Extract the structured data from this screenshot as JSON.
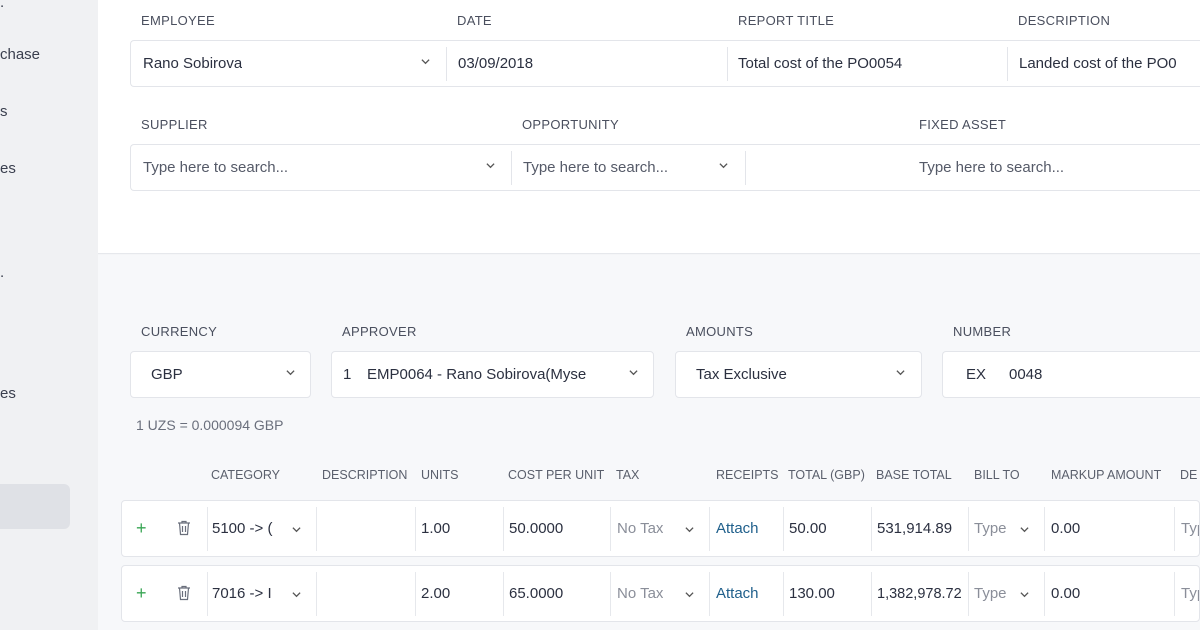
{
  "sidebar": {
    "items": [
      {
        "label": "."
      },
      {
        "label": "chase"
      },
      {
        "label": "s"
      },
      {
        "label": "es"
      },
      {
        "label": "."
      },
      {
        "label": "es"
      }
    ]
  },
  "header_form": {
    "employee": {
      "label": "EMPLOYEE",
      "value": "Rano Sobirova"
    },
    "date": {
      "label": "DATE",
      "value": "03/09/2018"
    },
    "report_title": {
      "label": "REPORT TITLE",
      "value": "Total cost of the PO0054"
    },
    "description": {
      "label": "DESCRIPTION",
      "value": "Landed cost of the PO0"
    },
    "supplier": {
      "label": "SUPPLIER",
      "placeholder": "Type here to search..."
    },
    "opportunity": {
      "label": "OPPORTUNITY",
      "placeholder": "Type here to search..."
    },
    "fixed_asset": {
      "label": "FIXED ASSET",
      "placeholder": "Type here to search..."
    }
  },
  "settings": {
    "currency": {
      "label": "CURRENCY",
      "value": "GBP"
    },
    "approver": {
      "label": "APPROVER",
      "index": "1",
      "value": "EMP0064 - Rano Sobirova(Myse"
    },
    "amounts": {
      "label": "AMOUNTS",
      "value": "Tax Exclusive"
    },
    "number": {
      "label": "NUMBER",
      "prefix": "EX",
      "value": "0048"
    },
    "rate": "1 UZS = 0.000094 GBP"
  },
  "table": {
    "columns": {
      "category": "CATEGORY",
      "description": "DESCRIPTION",
      "units": "UNITS",
      "cost_per_unit": "COST PER UNIT",
      "tax": "TAX",
      "receipts": "RECEIPTS",
      "total": "TOTAL (GBP)",
      "base_total": "BASE TOTAL",
      "bill_to": "BILL TO",
      "markup_amount": "MARKUP AMOUNT",
      "extra": "DE"
    },
    "rows": [
      {
        "plus": "+",
        "category": "5100 -> (",
        "description": "",
        "units": "1.00",
        "cost_per_unit": "50.0000",
        "tax": "No Tax",
        "receipts": "Attach",
        "total": "50.00",
        "base_total": "531,914.89",
        "bill_to": "Type",
        "markup_amount": "0.00",
        "extra": "Typ"
      },
      {
        "plus": "+",
        "category": "7016 -> I",
        "description": "",
        "units": "2.00",
        "cost_per_unit": "65.0000",
        "tax": "No Tax",
        "receipts": "Attach",
        "total": "130.00",
        "base_total": "1,382,978.72",
        "bill_to": "Type",
        "markup_amount": "0.00",
        "extra": "Typ"
      }
    ]
  },
  "colors": {
    "accent_green": "#3aa655",
    "link_blue": "#1f5f8b"
  }
}
